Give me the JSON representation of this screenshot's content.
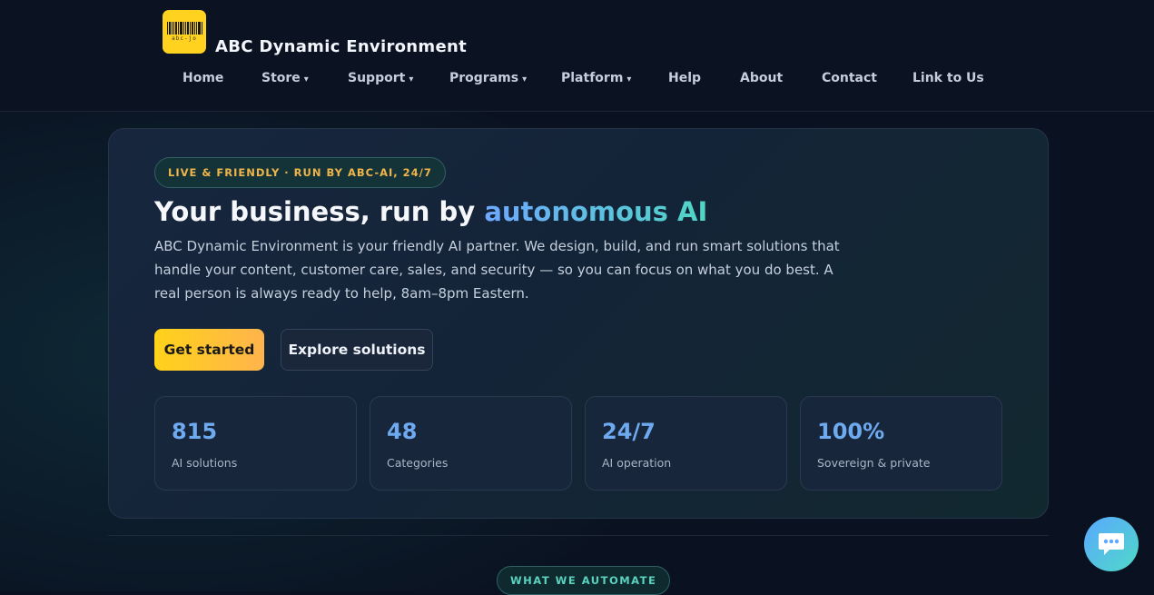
{
  "header": {
    "logo_text": "abc-jo",
    "brand": "ABC Dynamic Environment",
    "nav": [
      {
        "label": "Home",
        "caret": ""
      },
      {
        "label": "Store",
        "caret": "▾"
      },
      {
        "label": "Support",
        "caret": "▾"
      },
      {
        "label": "Programs",
        "caret": "▾"
      },
      {
        "label": "Platform",
        "caret": "▾"
      },
      {
        "label": "Help",
        "caret": ""
      },
      {
        "label": "About",
        "caret": ""
      },
      {
        "label": "Contact",
        "caret": ""
      },
      {
        "label": "Link to Us",
        "caret": ""
      }
    ]
  },
  "hero": {
    "pill": "LIVE & FRIENDLY · RUN BY ABC-AI, 24/7",
    "headline_prefix": "Your business, run by ",
    "headline_accent": "autonomous AI",
    "lede": "ABC Dynamic Environment is your friendly AI partner. We design, build, and run smart solutions that handle your content, customer care, sales, and security — so you can focus on what you do best. A real person is always ready to help, 8am–8pm Eastern.",
    "primary_button": "Get started",
    "secondary_button": "Explore solutions",
    "stats": [
      {
        "value": "815",
        "label": "AI solutions"
      },
      {
        "value": "48",
        "label": "Categories"
      },
      {
        "value": "24/7",
        "label": "AI operation"
      },
      {
        "value": "100%",
        "label": "Sovereign & private"
      }
    ]
  },
  "section": {
    "pill": "WHAT WE AUTOMATE"
  },
  "colors": {
    "accent_yellow": "#ffd21f",
    "accent_blue": "#6eaaf0",
    "accent_teal": "#4fd6c4",
    "background": "#0a1120"
  },
  "icons": {
    "logo": "barcode-icon",
    "chat": "chat-bubble-icon"
  }
}
